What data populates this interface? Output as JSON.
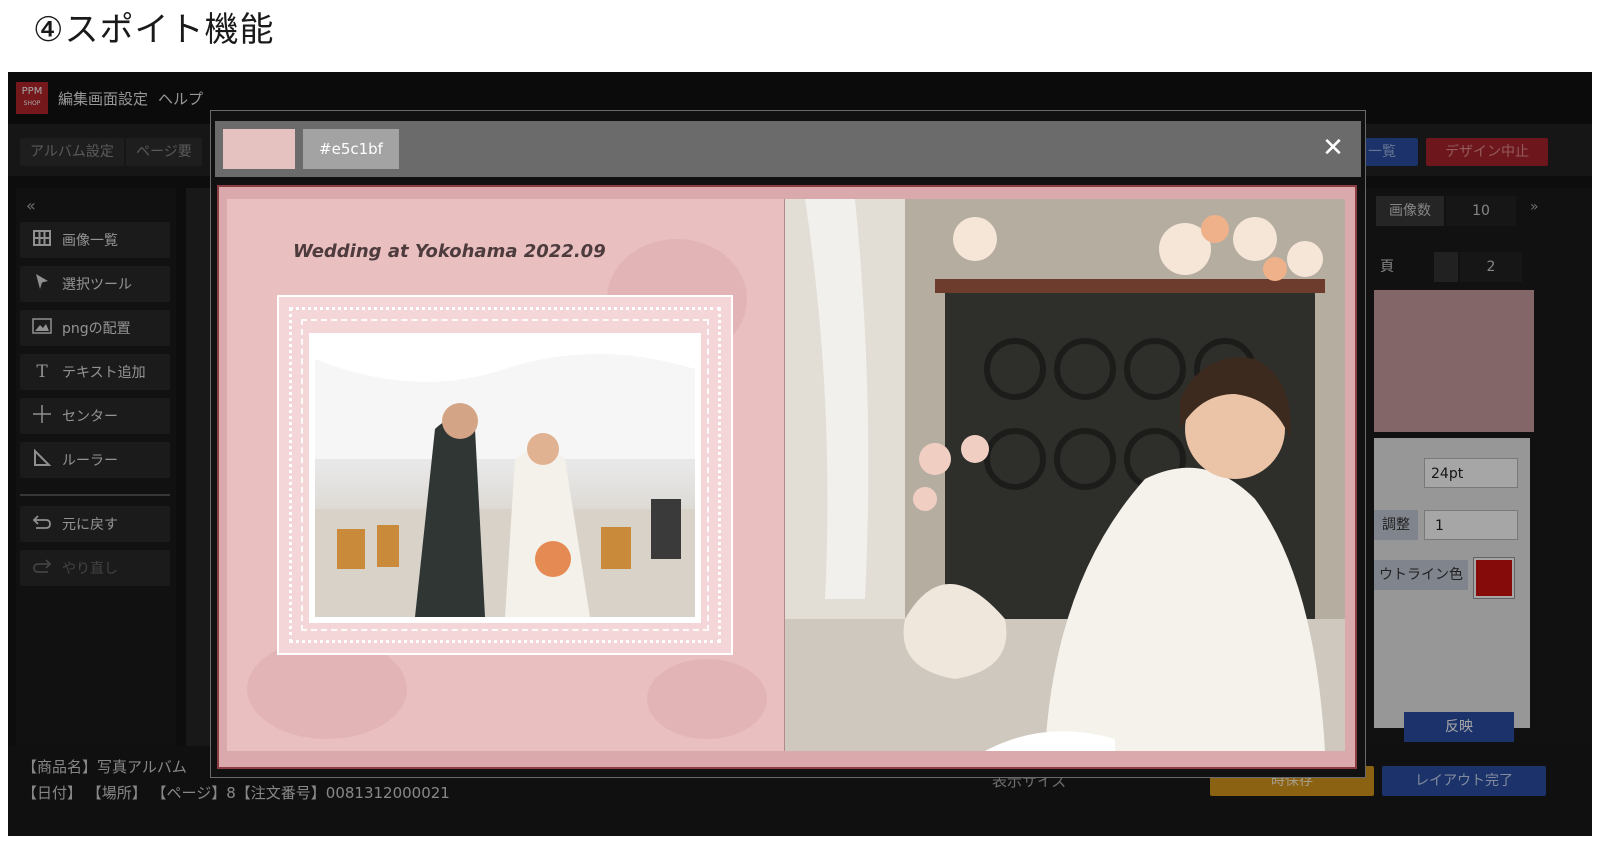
{
  "heading": "④スポイト機能",
  "app": {
    "logo": "PPM\nSHOP",
    "menu": [
      "編集画面設定",
      "ヘルプ"
    ],
    "toolbar": {
      "album_settings": "アルバム設定",
      "page_settings": "ページ要",
      "list_button": "一覧",
      "cancel_design": "デザイン中止"
    },
    "sidebar": {
      "collapse": "«",
      "items": [
        {
          "label": "画像一覧",
          "icon": "grid-icon"
        },
        {
          "label": "選択ツール",
          "icon": "cursor-icon"
        },
        {
          "label": "pngの配置",
          "icon": "image-icon"
        },
        {
          "label": "テキスト追加",
          "icon": "text-icon"
        },
        {
          "label": "センター",
          "icon": "crosshair-icon"
        },
        {
          "label": "ルーラー",
          "icon": "ruler-icon"
        },
        {
          "label": "元に戻す",
          "icon": "undo-icon"
        },
        {
          "label": "やり直し",
          "icon": "redo-icon"
        }
      ]
    },
    "right_panel": {
      "expand": "»",
      "image_count_label": "画像数",
      "image_count": "10",
      "page_label": "頁",
      "page_value": "2",
      "font_size": "24pt",
      "adjust_label": "調整",
      "adjust_value": "1",
      "outline_color_label": "ウトライン色",
      "outline_color": "#cc1111",
      "apply_button": "反映"
    },
    "status": {
      "line1": "【商品名】写真アルバム",
      "line2": "【日付】 【場所】 【ページ】8【注文番号】0081312000021",
      "display_size": "表示サイズ",
      "save_button": "時保存",
      "layout_done": "レイアウト完了"
    }
  },
  "modal": {
    "swatch_color": "#e5c1bf",
    "hex_value": "#e5c1bf",
    "close": "✕",
    "album_title": "Wedding at Yokohama 2022.09"
  }
}
